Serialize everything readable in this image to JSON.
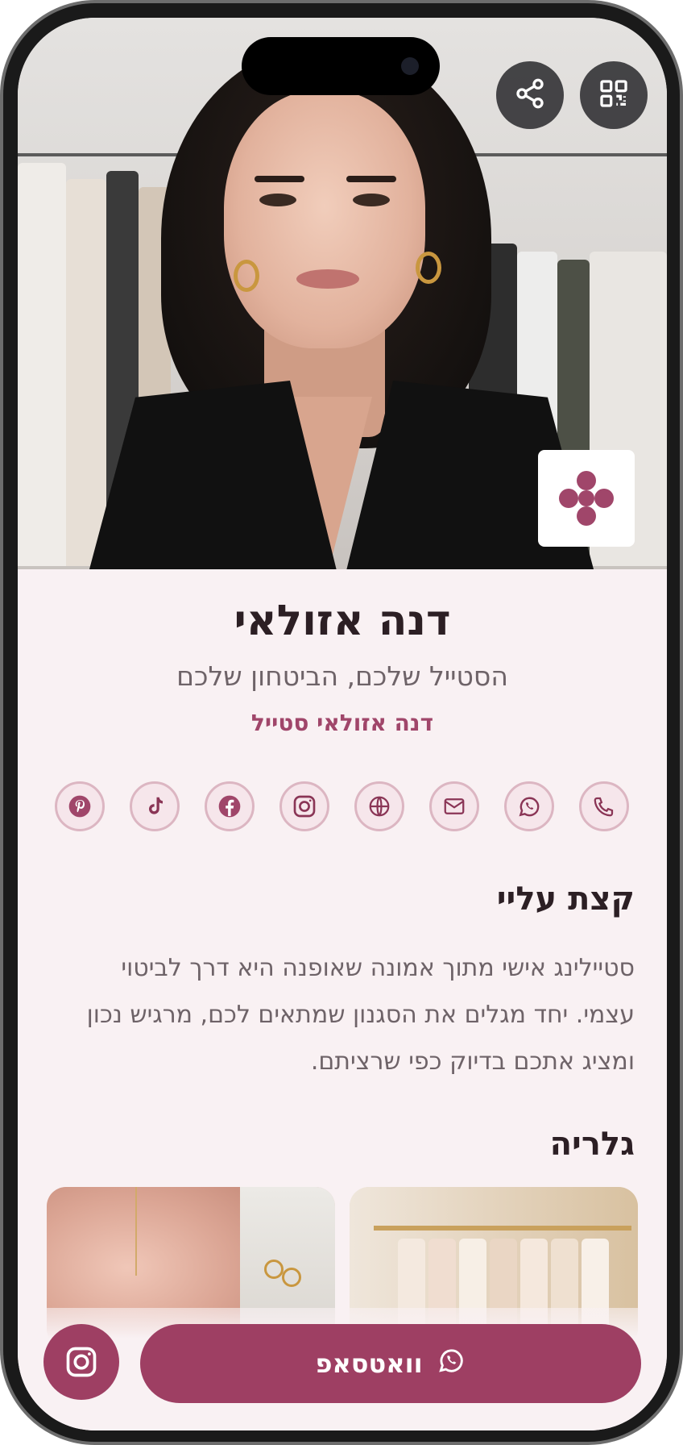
{
  "profile": {
    "name": "דנה אזולאי",
    "tagline": "הסטייל שלכם, הביטחון שלכם",
    "brand": "דנה אזולאי סטייל"
  },
  "header": {
    "share_icon": "share-icon",
    "qr_icon": "qr-code-icon"
  },
  "socials": [
    {
      "icon": "phone-icon"
    },
    {
      "icon": "whatsapp-icon"
    },
    {
      "icon": "mail-icon"
    },
    {
      "icon": "globe-icon"
    },
    {
      "icon": "instagram-icon"
    },
    {
      "icon": "facebook-icon"
    },
    {
      "icon": "tiktok-icon"
    },
    {
      "icon": "pinterest-icon"
    }
  ],
  "about": {
    "title": "קצת עליי",
    "text": "סטיילינג אישי מתוך אמונה שאופנה היא דרך לביטוי עצמי. יחד מגלים את הסגנון שמתאים לכם, מרגיש נכון ומציג אתכם בדיוק כפי שרציתם."
  },
  "gallery": {
    "title": "גלריה"
  },
  "actions": {
    "whatsapp_label": "וואטסאפ"
  },
  "colors": {
    "accent": "#9e3f63",
    "background": "#f9f1f3",
    "heading": "#2c1f24",
    "body_text": "#6e6368"
  }
}
